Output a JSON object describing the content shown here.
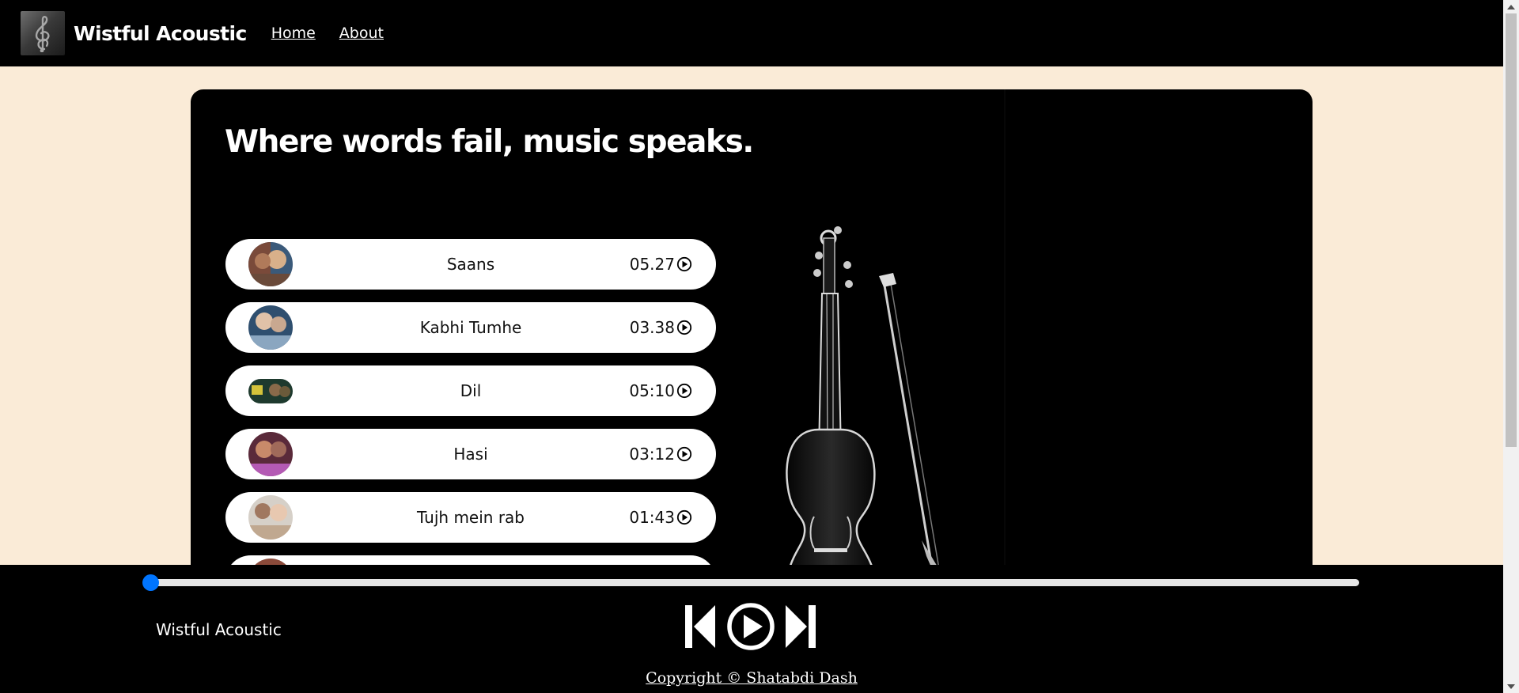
{
  "nav": {
    "brand": "Wistful Acoustic",
    "links": [
      {
        "label": "Home"
      },
      {
        "label": "About"
      }
    ]
  },
  "hero": {
    "headline": "Where words fail, music speaks."
  },
  "songs": [
    {
      "name": "Saans",
      "duration": "05.27",
      "thumb_colors": [
        "#7a4a3a",
        "#d8b08a",
        "#3b5a7a"
      ]
    },
    {
      "name": "Kabhi Tumhe",
      "duration": "03.38",
      "thumb_colors": [
        "#2f4f6f",
        "#e0c2a8",
        "#8aa6c0"
      ]
    },
    {
      "name": "Dil",
      "duration": "05:10",
      "thumb_colors": [
        "#1e3a2e",
        "#d4c23a",
        "#6b5a3a"
      ]
    },
    {
      "name": "Hasi",
      "duration": "03:12",
      "thumb_colors": [
        "#5a2a3a",
        "#c88a6a",
        "#b45ab4"
      ]
    },
    {
      "name": "Tujh mein rab",
      "duration": "01:43",
      "thumb_colors": [
        "#d6d0c8",
        "#a07860",
        "#e8c8b0"
      ]
    },
    {
      "name": "",
      "duration": "",
      "thumb_colors": [
        "#8a4a3a",
        "#c09080",
        "#4a3a3a"
      ]
    }
  ],
  "player": {
    "progress": 0,
    "now_playing": "Wistful Acoustic",
    "copyright": "Copyright © Shatabdi Dash"
  },
  "colors": {
    "accent": "#0075ff",
    "page_bg": "#faebd7",
    "nav_bg": "#000000"
  },
  "icons": [
    "treble-clef-icon",
    "play-circle-icon",
    "previous-track-icon",
    "play-icon",
    "next-track-icon",
    "violin-image"
  ]
}
